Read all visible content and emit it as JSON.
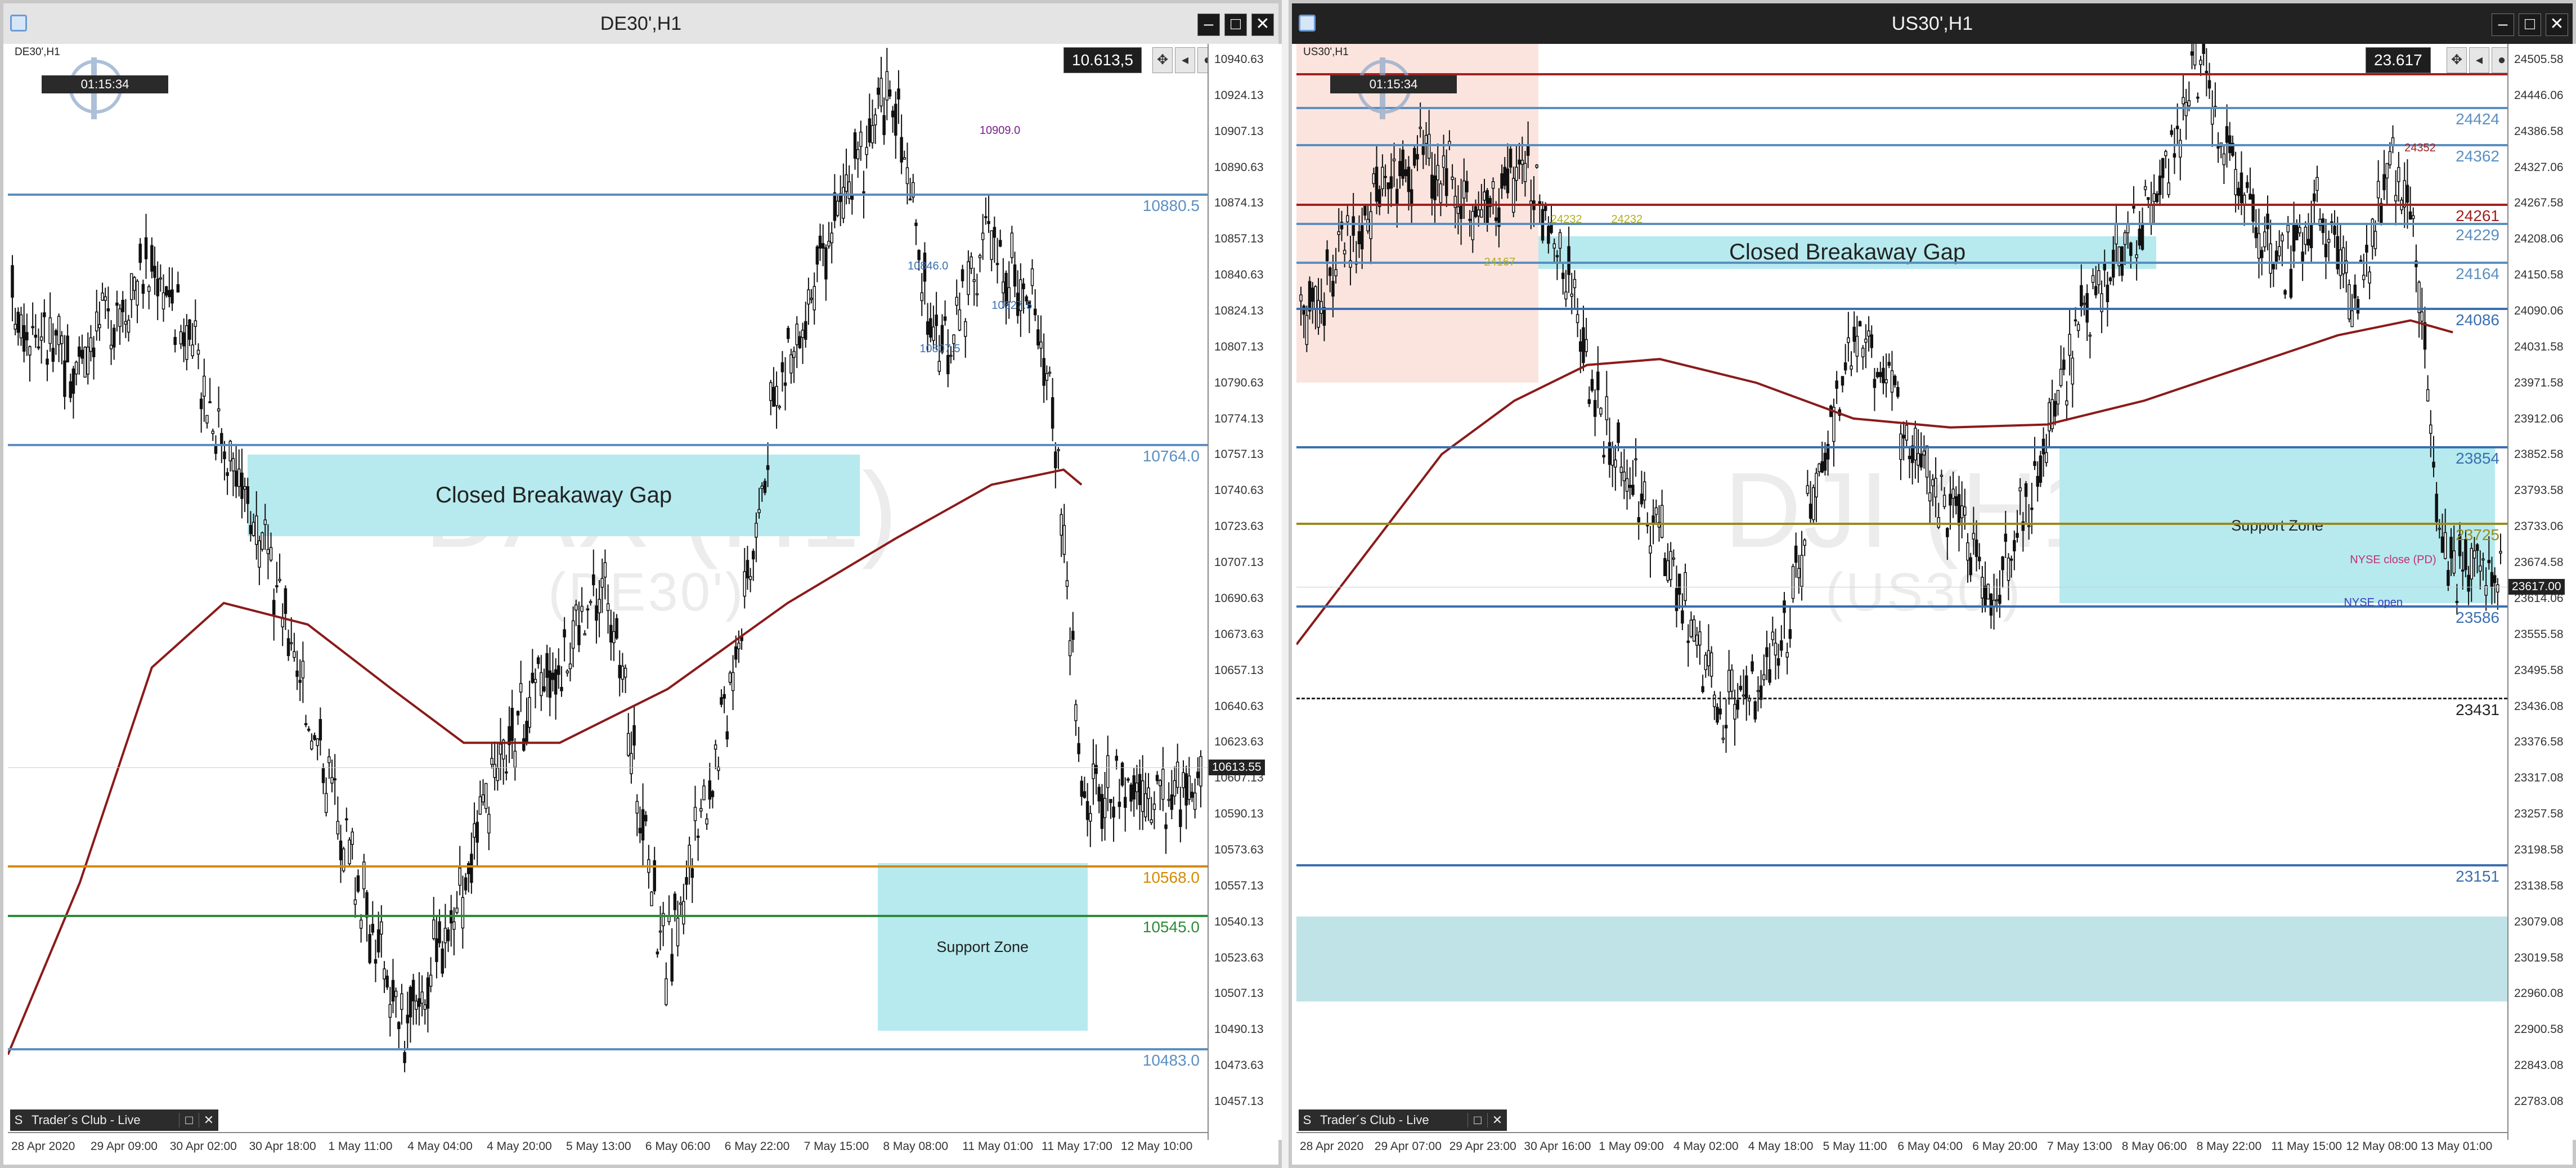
{
  "left": {
    "title": "DE30',H1",
    "symbol_tag": "DE30',H1",
    "timer": "01:15:34",
    "price_box": "10.613,5",
    "watermark": "DAX (H1)",
    "watermark_sub": "(DE30')",
    "tab_label": "Trader´s Club - Live",
    "y_range": [
      10455,
      10950
    ],
    "y_labels": [
      "10940.63",
      "10924.13",
      "10907.13",
      "10890.63",
      "10874.13",
      "10857.13",
      "10840.63",
      "10824.13",
      "10807.13",
      "10790.63",
      "10774.13",
      "10757.13",
      "10740.63",
      "10723.63",
      "10707.13",
      "10690.63",
      "10673.63",
      "10657.13",
      "10640.63",
      "10623.63",
      "10607.13",
      "10590.13",
      "10573.63",
      "10557.13",
      "10540.13",
      "10523.63",
      "10507.13",
      "10490.13",
      "10473.63",
      "10457.13"
    ],
    "current_price_label": "10613.55",
    "current_price": 10613.5,
    "x_labels": [
      "28 Apr 2020",
      "29 Apr 09:00",
      "30 Apr 02:00",
      "30 Apr 18:00",
      "1 May 11:00",
      "4 May 04:00",
      "4 May 20:00",
      "5 May 13:00",
      "6 May 06:00",
      "6 May 22:00",
      "7 May 15:00",
      "8 May 08:00",
      "11 May 01:00",
      "11 May 17:00",
      "12 May 10:00"
    ],
    "zones": [
      {
        "label": "Closed Breakaway Gap",
        "y_top": 10759,
        "y_bottom": 10721,
        "x_from": 0.2,
        "x_to": 0.71
      },
      {
        "label": "Support Zone",
        "y_top": 10569,
        "y_bottom": 10491,
        "x_from": 0.725,
        "x_to": 0.9
      }
    ],
    "levels": [
      {
        "value": 10880.5,
        "label": "10880.5",
        "color": "#5b8fc0"
      },
      {
        "value": 10764.0,
        "label": "10764.0",
        "color": "#5b8fc0"
      },
      {
        "value": 10568.0,
        "label": "10568.0",
        "color": "#d48a00"
      },
      {
        "value": 10545.0,
        "label": "10545.0",
        "color": "#2e8a3a"
      },
      {
        "value": 10483.0,
        "label": "10483.0",
        "color": "#5b8fc0"
      }
    ],
    "small_texts": [
      {
        "text": "10909.0",
        "value": 10909,
        "x": 0.81,
        "color": "#7a1f8a"
      },
      {
        "text": "10846.0",
        "value": 10846,
        "x": 0.75,
        "color": "#3a6fb0"
      },
      {
        "text": "10827.5",
        "value": 10827.5,
        "x": 0.82,
        "color": "#3a6fb0"
      },
      {
        "text": "10807.5",
        "value": 10807.5,
        "x": 0.76,
        "color": "#3a6fb0"
      }
    ]
  },
  "right": {
    "title": "US30',H1",
    "symbol_tag": "US30',H1",
    "timer": "01:15:34",
    "price_box": "23.617",
    "watermark": "DJI (H1)",
    "watermark_sub": "(US30')",
    "tab_label": "Trader´s Club - Live",
    "y_range": [
      22740,
      24530
    ],
    "y_labels": [
      "24505.58",
      "24446.06",
      "24386.58",
      "24327.06",
      "24267.58",
      "24208.06",
      "24150.58",
      "24090.06",
      "24031.58",
      "23971.58",
      "23912.06",
      "23852.58",
      "23793.58",
      "23733.06",
      "23674.58",
      "23614.06",
      "23555.58",
      "23495.58",
      "23436.08",
      "23376.58",
      "23317.08",
      "23257.58",
      "23198.58",
      "23138.58",
      "23079.08",
      "23019.58",
      "22960.08",
      "22900.58",
      "22843.08",
      "22783.08"
    ],
    "current_price_label": "23617.00",
    "current_price": 23617,
    "x_labels": [
      "28 Apr 2020",
      "29 Apr 07:00",
      "29 Apr 23:00",
      "30 Apr 16:00",
      "1 May 09:00",
      "4 May 02:00",
      "4 May 18:00",
      "5 May 11:00",
      "6 May 04:00",
      "6 May 20:00",
      "7 May 13:00",
      "8 May 06:00",
      "8 May 22:00",
      "11 May 15:00",
      "12 May 08:00",
      "13 May 01:00"
    ],
    "zones": [
      {
        "label": "Closed Breakaway Gap",
        "y_top": 24206,
        "y_bottom": 24152,
        "x_from": 0.2,
        "x_to": 0.71
      },
      {
        "label": "Support Zone",
        "y_top": 23850,
        "y_bottom": 23590,
        "x_from": 0.63,
        "x_to": 0.99
      },
      {
        "label": "",
        "y_top": 23063,
        "y_bottom": 22920,
        "x_from": 0.0,
        "x_to": 1.0
      }
    ],
    "levels": [
      {
        "value": 24481,
        "label": "",
        "color": "#a02020"
      },
      {
        "value": 24424,
        "label": "24424",
        "color": "#5b8fc0"
      },
      {
        "value": 24362,
        "label": "24362",
        "color": "#5b8fc0"
      },
      {
        "value": 24261,
        "label": "24261",
        "color": "#a02020"
      },
      {
        "value": 24229,
        "label": "24229",
        "color": "#5b8fc0"
      },
      {
        "value": 24164,
        "label": "24164",
        "color": "#5b8fc0"
      },
      {
        "value": 24086,
        "label": "24086",
        "color": "#3a6fb0"
      },
      {
        "value": 23854,
        "label": "23854",
        "color": "#3a6fb0"
      },
      {
        "value": 23725,
        "label": "23725",
        "color": "#9a8a20"
      },
      {
        "value": 23586,
        "label": "23586",
        "color": "#3a6fb0"
      },
      {
        "value": 23431,
        "label": "23431",
        "color": "#222222"
      },
      {
        "value": 23151,
        "label": "23151",
        "color": "#3a6fb0"
      }
    ],
    "small_texts": [
      {
        "text": "24232",
        "value": 24232,
        "x": 0.21,
        "color": "#b0b020"
      },
      {
        "text": "24232",
        "value": 24232,
        "x": 0.26,
        "color": "#b0b020"
      },
      {
        "text": "24167",
        "value": 24160,
        "x": 0.155,
        "color": "#b0b020"
      },
      {
        "text": "24352",
        "value": 24352,
        "x": 0.915,
        "color": "#a02020"
      },
      {
        "text": "NYSE close (PD)",
        "value": 23660,
        "x": 0.87,
        "color": "#c0307a"
      },
      {
        "text": "NYSE open",
        "value": 23588,
        "x": 0.865,
        "color": "#3a3ac0"
      }
    ]
  },
  "colors": {
    "candle": "#111111",
    "ma": "#8b1a1a",
    "zone": "#b6eaee",
    "pink": "#fbe4de"
  }
}
